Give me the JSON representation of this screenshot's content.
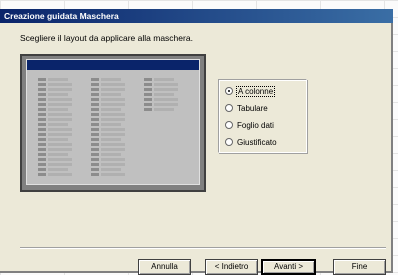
{
  "window": {
    "title": "Creazione guidata Maschera"
  },
  "instruction": "Scegliere il layout da applicare alla maschera.",
  "layout_options": [
    {
      "label": "A colonne",
      "checked": true
    },
    {
      "label": "Tabulare",
      "checked": false
    },
    {
      "label": "Foglio dati",
      "checked": false
    },
    {
      "label": "Giustificato",
      "checked": false
    }
  ],
  "buttons": {
    "cancel": "Annulla",
    "back": "< Indietro",
    "next": "Avanti >",
    "finish": "Fine"
  }
}
